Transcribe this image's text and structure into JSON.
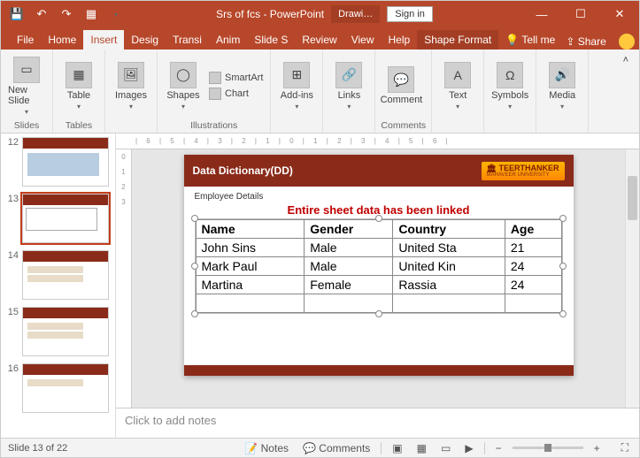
{
  "titlebar": {
    "save_icon": "💾",
    "undo_icon": "↶",
    "redo_icon": "↷",
    "start_icon": "▦",
    "doc_title": "Srs of fcs - PowerPoint",
    "tool_tab": "Drawi…",
    "sign_in": "Sign in",
    "min": "—",
    "max": "☐",
    "close": "✕"
  },
  "tabs": {
    "file": "File",
    "home": "Home",
    "insert": "Insert",
    "design": "Desig",
    "transitions": "Transi",
    "animations": "Anim",
    "slideshow": "Slide S",
    "review": "Review",
    "view": "View",
    "help": "Help",
    "shapeformat": "Shape Format",
    "tellme_icon": "💡",
    "tellme": "Tell me",
    "share_icon": "⇪",
    "share": "Share"
  },
  "ribbon": {
    "newslide": "New Slide",
    "slides": "Slides",
    "table": "Table",
    "tables": "Tables",
    "images": "Images",
    "shapes": "Shapes",
    "smartart": "SmartArt",
    "chart": "Chart",
    "illustrations": "Illustrations",
    "addins": "Add-ins",
    "links": "Links",
    "comment": "Comment",
    "comments": "Comments",
    "text": "Text",
    "symbols": "Symbols",
    "media": "Media"
  },
  "thumbs": {
    "n12": "12",
    "n13": "13",
    "n14": "14",
    "n15": "15",
    "n16": "16"
  },
  "slide": {
    "header": "Data Dictionary(DD)",
    "uni_name": "TEERTHANKER",
    "uni_sub": "MAHAVEER UNIVERSITY",
    "section": "Employee Details",
    "linked_msg": "Entire sheet data has been linked",
    "col_name": "Name",
    "col_gender": "Gender",
    "col_country": "Country",
    "col_age": "Age",
    "r1_name": "John Sins",
    "r1_gender": "Male",
    "r1_country": "United Sta",
    "r1_age": "21",
    "r2_name": "Mark Paul",
    "r2_gender": "Male",
    "r2_country": "United Kin",
    "r2_age": "24",
    "r3_name": "Martina",
    "r3_gender": "Female",
    "r3_country": "Rassia",
    "r3_age": "24"
  },
  "notes": {
    "placeholder": "Click to add notes"
  },
  "status": {
    "slide_of": "Slide 13 of 22",
    "lang": "",
    "notes": "Notes",
    "comments": "Comments",
    "zoom_pct": "",
    "fit": "⛶"
  },
  "ruler": {
    "h": "| 6 | 5 | 4 | 3 | 2 | 1 | 0 | 1 | 2 | 3 | 4 | 5 | 6 |",
    "v0": "0",
    "v1": "1",
    "v2": "2",
    "v3": "3"
  }
}
